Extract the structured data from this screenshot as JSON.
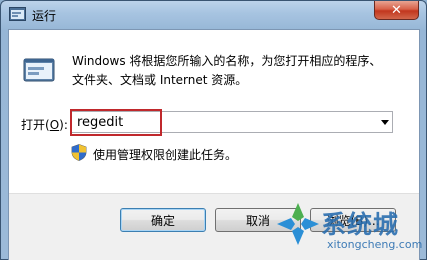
{
  "window": {
    "title": "运行",
    "close_label": "✕"
  },
  "content": {
    "description_line1": "Windows 将根据您所输入的名称，为您打开相应的程序、",
    "description_line2": "文件夹、文档或 Internet 资源。",
    "open_label_prefix": "打开(",
    "open_label_key": "O",
    "open_label_suffix": "):",
    "input_value": "regedit",
    "admin_note": "使用管理权限创建此任务。"
  },
  "buttons": {
    "ok": "确定",
    "cancel": "取消",
    "browse": "浏览(B)..."
  },
  "watermark": {
    "brand": "系统城",
    "site": "xitongcheng.com"
  },
  "colors": {
    "highlight_border": "#c0282c",
    "close_red": "#c2371e",
    "watermark_blue": "#2b6fb0"
  },
  "icons": [
    "run-app-icon",
    "run-dialog-icon",
    "uac-shield-icon",
    "dropdown-arrow-icon",
    "close-icon",
    "watermark-logo-icon"
  ]
}
